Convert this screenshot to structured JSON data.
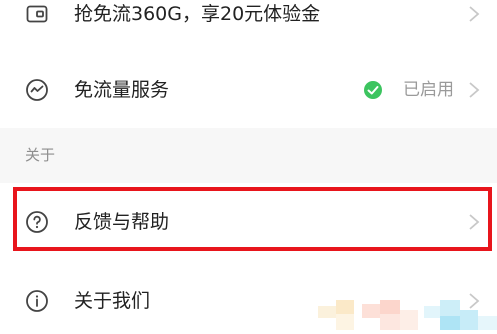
{
  "menu": {
    "promo": {
      "label": "抢免流360G，享20元体验金",
      "icon": "card-icon"
    },
    "free_data": {
      "label": "免流量服务",
      "status": "已启用",
      "status_icon": "check-circle-icon",
      "status_color": "#3cc45f",
      "icon": "wave-circle-icon"
    }
  },
  "section": {
    "title": "关于"
  },
  "about_menu": {
    "feedback": {
      "label": "反馈与帮助",
      "icon": "question-circle-icon"
    },
    "about_us": {
      "label": "关于我们",
      "icon": "info-circle-icon"
    }
  },
  "colors": {
    "highlight": "#e8151c",
    "icon_gray": "#444444",
    "chevron_gray": "#c8c8c8",
    "section_bg": "#f7f7f7"
  }
}
